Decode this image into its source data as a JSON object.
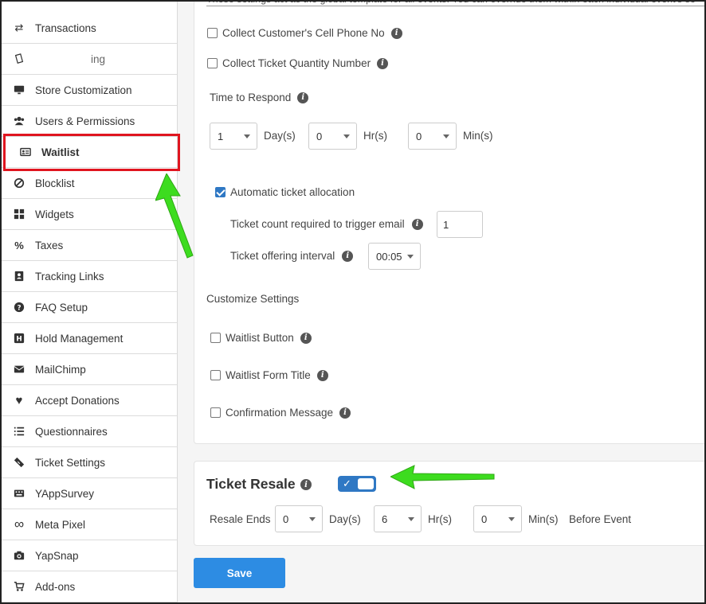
{
  "sidebar": {
    "items": [
      {
        "label": "Transactions",
        "icon": "transfer-icon"
      },
      {
        "label": "ing",
        "icon": "ticket-scan-icon"
      },
      {
        "label": "Store Customization",
        "icon": "monitor-icon"
      },
      {
        "label": "Users & Permissions",
        "icon": "users-icon"
      },
      {
        "label": "Waitlist",
        "icon": "id-card-icon"
      },
      {
        "label": "Blocklist",
        "icon": "ban-icon"
      },
      {
        "label": "Widgets",
        "icon": "grid-icon"
      },
      {
        "label": "Taxes",
        "icon": "percent-icon"
      },
      {
        "label": "Tracking Links",
        "icon": "contact-book-icon"
      },
      {
        "label": "FAQ Setup",
        "icon": "question-circle-icon"
      },
      {
        "label": "Hold Management",
        "icon": "h-square-icon"
      },
      {
        "label": "MailChimp",
        "icon": "envelope-icon"
      },
      {
        "label": "Accept Donations",
        "icon": "heart-icon"
      },
      {
        "label": "Questionnaires",
        "icon": "list-icon"
      },
      {
        "label": "Ticket Settings",
        "icon": "ticket-icon"
      },
      {
        "label": "YAppSurvey",
        "icon": "keyboard-icon"
      },
      {
        "label": "Meta Pixel",
        "icon": "meta-infinity-icon"
      },
      {
        "label": "YapSnap",
        "icon": "camera-icon"
      },
      {
        "label": "Add-ons",
        "icon": "cart-icon"
      }
    ]
  },
  "settings": {
    "note": "These settings act as the global template for all events. You can override them within each individual event's se",
    "cell_phone_label": "Collect Customer's Cell Phone No",
    "ticket_qty_label": "Collect Ticket Quantity Number",
    "time_to_respond_label": "Time to Respond",
    "days_value": "1",
    "days_unit": "Day(s)",
    "hrs_value": "0",
    "hrs_unit": "Hr(s)",
    "mins_value": "0",
    "mins_unit": "Min(s)",
    "auto_alloc_label": "Automatic ticket allocation",
    "auto_alloc_checked": true,
    "ticket_count_label": "Ticket count required to trigger email",
    "ticket_count_value": "1",
    "offering_interval_label": "Ticket offering interval",
    "offering_interval_value": "00:05",
    "customize_label": "Customize Settings",
    "waitlist_button_label": "Waitlist Button",
    "waitlist_form_title_label": "Waitlist Form Title",
    "confirmation_message_label": "Confirmation Message"
  },
  "resale": {
    "title": "Ticket Resale",
    "toggle_on": true,
    "ends_label": "Resale Ends",
    "days_value": "0",
    "days_unit": "Day(s)",
    "hrs_value": "6",
    "hrs_unit": "Hr(s)",
    "mins_value": "0",
    "mins_unit": "Min(s)",
    "before_event": "Before Event"
  },
  "save_label": "Save",
  "colors": {
    "accent": "#2d8ce3",
    "highlight_box": "#e0151f",
    "annotation_arrow": "#3ddc1f"
  }
}
